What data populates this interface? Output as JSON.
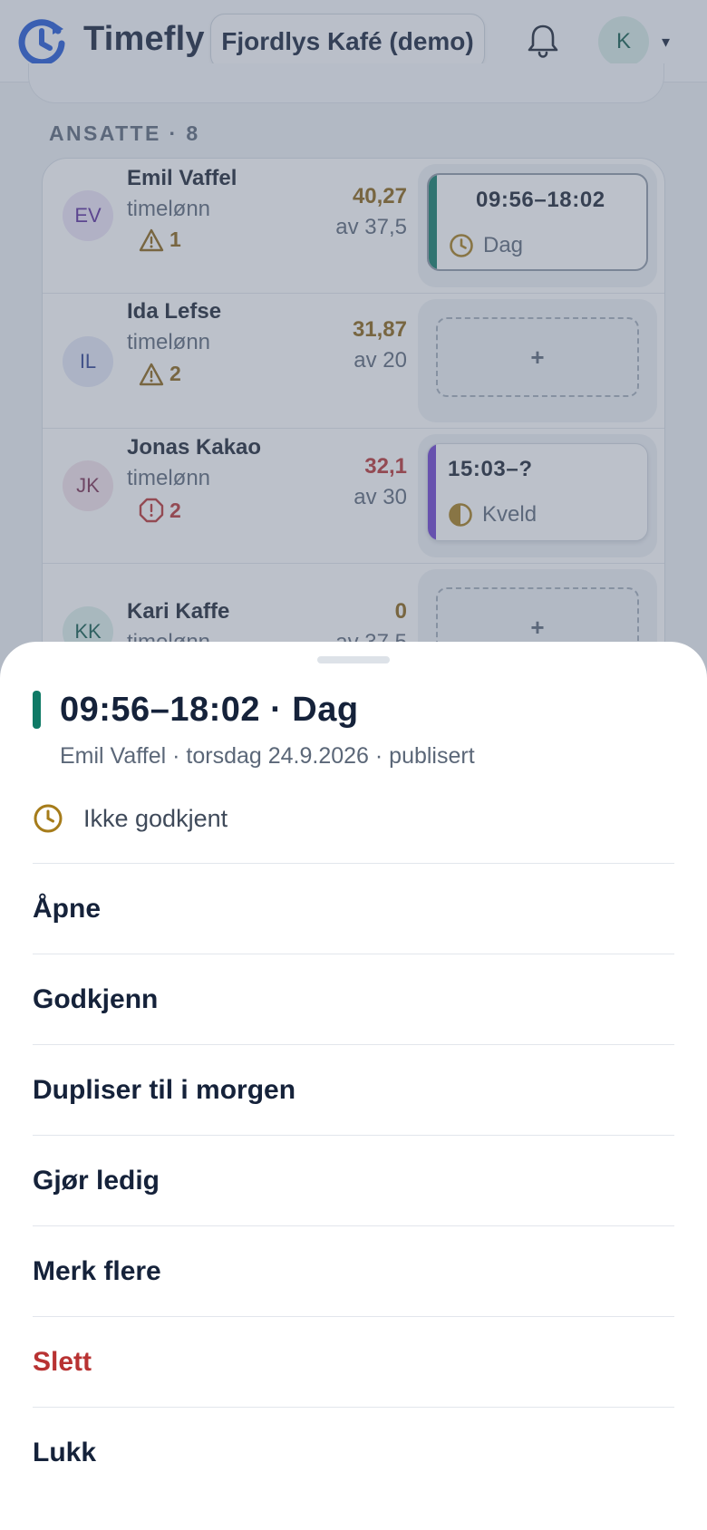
{
  "header": {
    "brand": "Timefly",
    "organization": "Fjordlys Kafé (demo)",
    "user_initial": "K",
    "menu_caret": "▾"
  },
  "schedule": {
    "section_label": "ANSATTE · 8",
    "employees": [
      {
        "initials": "EV",
        "name": "Emil Vaffel",
        "pay_type": "timelønn",
        "warning_count": "1",
        "warning_kind": "warning",
        "hours": "40,27",
        "target": "av 37,5",
        "hours_color": "#8a6314",
        "avatar_bg": "#ece3f7",
        "avatar_color": "#5b2c9b",
        "shift": {
          "time": "09:56–18:02",
          "kind": "Dag",
          "stripe": "#0f7a66",
          "icon": "clock-icon"
        }
      },
      {
        "initials": "IL",
        "name": "Ida Lefse",
        "pay_type": "timelønn",
        "warning_count": "2",
        "warning_kind": "warning",
        "hours": "31,87",
        "target": "av 20",
        "hours_color": "#8a6314",
        "avatar_bg": "#e3e7f6",
        "avatar_color": "#2c3f8f",
        "add_label": "+"
      },
      {
        "initials": "JK",
        "name": "Jonas Kakao",
        "pay_type": "timelønn",
        "warning_count": "2",
        "warning_kind": "error",
        "hours": "32,1",
        "target": "av 30",
        "hours_color": "#b83232",
        "avatar_bg": "#f3e2ea",
        "avatar_color": "#7a2f52",
        "shift": {
          "time": "15:03–?",
          "kind": "Kveld",
          "stripe": "#6d3fcf",
          "icon": "half-circle-icon"
        }
      },
      {
        "initials": "KK",
        "name": "Kari Kaffe",
        "pay_type": "timelønn",
        "hours": "0",
        "target": "av 37,5",
        "hours_color": "#8a6314",
        "avatar_bg": "#dcefeb",
        "avatar_color": "#0f5a4b",
        "add_label": "+"
      }
    ]
  },
  "sheet": {
    "title": "09:56–18:02 · Dag",
    "subtitle": "Emil Vaffel · torsdag 24.9.2026 · publisert",
    "status": "Ikke godkjent",
    "accent": "#0f7a66",
    "actions": [
      {
        "label": "Åpne"
      },
      {
        "label": "Godkjenn"
      },
      {
        "label": "Dupliser til i morgen"
      },
      {
        "label": "Gjør ledig"
      },
      {
        "label": "Merk flere"
      },
      {
        "label": "Slett",
        "danger": true
      },
      {
        "label": "Lukk"
      }
    ]
  }
}
